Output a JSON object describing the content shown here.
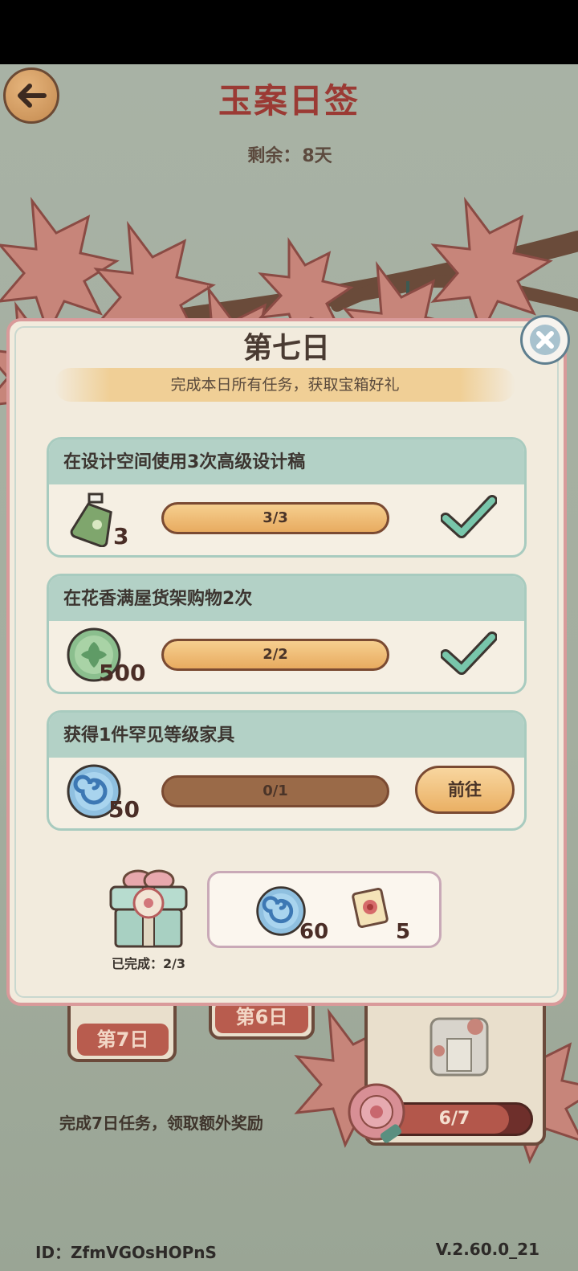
{
  "header": {
    "title": "玉案日签",
    "remaining_label": "剩余：",
    "remaining_value": "8天"
  },
  "panel": {
    "title": "第七日",
    "subtitle": "完成本日所有任务，获取宝箱好礼",
    "tasks": [
      {
        "title": "在设计空间使用3次高级设计稿",
        "reward_icon": "green-spray-bottle-icon",
        "reward_qty": "3",
        "progress_text": "3/3",
        "progress_fraction": 1.0,
        "status": "completed"
      },
      {
        "title": "在花香满屋货架购物2次",
        "reward_icon": "green-leaf-coin-icon",
        "reward_qty": "500",
        "progress_text": "2/2",
        "progress_fraction": 1.0,
        "status": "completed"
      },
      {
        "title": "获得1件罕见等级家具",
        "reward_icon": "blue-swirl-orb-icon",
        "reward_qty": "50",
        "progress_text": "0/1",
        "progress_fraction": 0.0,
        "status": "pending",
        "action_label": "前往"
      }
    ],
    "chest": {
      "label": "已完成：2/3",
      "icon": "gift-chest-icon"
    },
    "chest_rewards": [
      {
        "icon": "blue-swirl-orb-icon",
        "qty": "60"
      },
      {
        "icon": "flower-scroll-icon",
        "qty": "5"
      }
    ]
  },
  "background": {
    "day_cards": [
      "第7日",
      "第6日"
    ],
    "footer_text": "完成7日任务，领取额外奖励",
    "final_progress_text": "6/7",
    "final_progress_fraction": 0.857
  },
  "footer": {
    "id_text": "ID：ZfmVGOsHOPnS",
    "version": "V.2.60.0_21"
  },
  "colors": {
    "title_red": "#9b3a34",
    "panel_bg": "#f2ebdd",
    "task_header": "#b3d1c6",
    "progress_orange": "#e8ab60",
    "check_teal": "#6fbfa5"
  }
}
